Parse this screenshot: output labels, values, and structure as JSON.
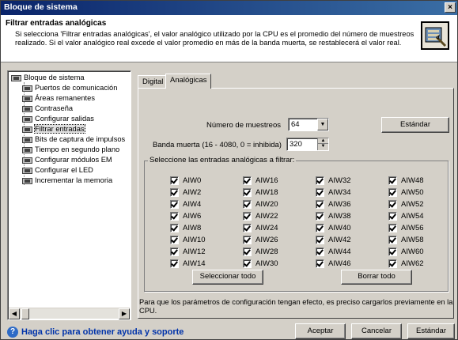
{
  "window": {
    "title": "Bloque de sistema",
    "close_label": "×"
  },
  "header": {
    "title": "Filtrar entradas analógicas",
    "description_line1": "Si selecciona 'Filtrar entradas analógicas', el valor analógico utilizado por la CPU es el promedio del número de muestreos",
    "description_line2": "realizado. Si el valor analógico real excede el valor promedio en más de la banda muerta, se restablecerá el valor real."
  },
  "tree": {
    "root": "Bloque de sistema",
    "items": [
      "Puertos de comunicación",
      "Áreas remanentes",
      "Contraseña",
      "Configurar salidas",
      "Filtrar entradas",
      "Bits de captura de impulsos",
      "Tiempo en segundo plano",
      "Configurar módulos EM",
      "Configurar el LED",
      "Incrementar la memoria"
    ]
  },
  "tabs": [
    "Digital",
    "Analógicas"
  ],
  "form": {
    "samples_label": "Número de muestreos",
    "samples_value": "64",
    "deadband_label": "Banda muerta (16 - 4080, 0 = inhibida)",
    "deadband_value": "320",
    "standard_button": "Estándar"
  },
  "group": {
    "title": "Seleccione las entradas analógicas a filtrar:",
    "col1": [
      "AIW0",
      "AIW2",
      "AIW4",
      "AIW6",
      "AIW8",
      "AIW10",
      "AIW12",
      "AIW14"
    ],
    "col2": [
      "AIW16",
      "AIW18",
      "AIW20",
      "AIW22",
      "AIW24",
      "AIW26",
      "AIW28",
      "AIW30"
    ],
    "col3": [
      "AIW32",
      "AIW34",
      "AIW36",
      "AIW38",
      "AIW40",
      "AIW42",
      "AIW44",
      "AIW46"
    ],
    "col4": [
      "AIW48",
      "AIW50",
      "AIW52",
      "AIW54",
      "AIW56",
      "AIW58",
      "AIW60",
      "AIW62"
    ],
    "select_all": "Seleccionar todo",
    "clear_all": "Borrar todo"
  },
  "note": "Para que los parámetros de configuración tengan efecto, es preciso cargarlos previamente en la CPU.",
  "footer": {
    "help": "Haga clic para obtener ayuda y soporte",
    "accept": "Aceptar",
    "cancel": "Cancelar",
    "standard": "Estándar"
  }
}
